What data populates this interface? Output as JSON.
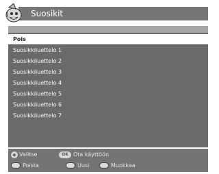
{
  "window": {
    "title": "Suosikit",
    "icon": "wizard-icon"
  },
  "list": {
    "items": [
      {
        "label": "Pois",
        "selected": true
      },
      {
        "label": "Suosikkiluettelo 1",
        "selected": false
      },
      {
        "label": "Suosikkiluettelo 2",
        "selected": false
      },
      {
        "label": "Suosikkiluettelo 3",
        "selected": false
      },
      {
        "label": "Suosikkiluettelo 4",
        "selected": false
      },
      {
        "label": "Suosikkiluettelo 5",
        "selected": false
      },
      {
        "label": "Suosikkiluettelo 6",
        "selected": false
      },
      {
        "label": "Suosikkiluettelo 7",
        "selected": false
      }
    ]
  },
  "footer": {
    "select_hint": "Valitse",
    "ok_key": "OK",
    "ok_hint": "Ota käyttöön",
    "delete_label": "Poista",
    "new_label": "Uusi",
    "edit_label": "Muokkaa"
  },
  "colors": {
    "title_bar": "#767676",
    "list_background": "#6a6a6a",
    "selection": "#ffffff",
    "footer_background": "#747474"
  }
}
